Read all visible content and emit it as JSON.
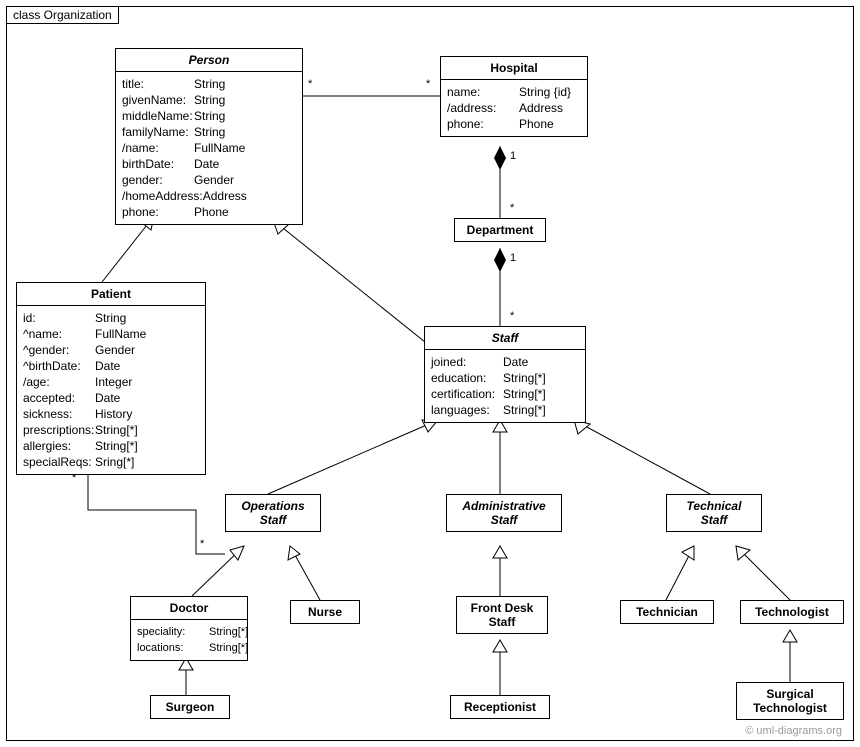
{
  "frame": {
    "label": "class Organization"
  },
  "classes": {
    "person": {
      "name": "Person",
      "abstract": true,
      "attrs": [
        {
          "name": "title:",
          "type": "String"
        },
        {
          "name": "givenName:",
          "type": "String"
        },
        {
          "name": "middleName:",
          "type": "String"
        },
        {
          "name": "familyName:",
          "type": "String"
        },
        {
          "name": "/name:",
          "type": "FullName"
        },
        {
          "name": "birthDate:",
          "type": "Date"
        },
        {
          "name": "gender:",
          "type": "Gender"
        },
        {
          "name": "/homeAddress:",
          "type": "Address"
        },
        {
          "name": "phone:",
          "type": "Phone"
        }
      ]
    },
    "hospital": {
      "name": "Hospital",
      "abstract": false,
      "attrs": [
        {
          "name": "name:",
          "type": "String {id}"
        },
        {
          "name": "/address:",
          "type": "Address"
        },
        {
          "name": "phone:",
          "type": "Phone"
        }
      ]
    },
    "department": {
      "name": "Department",
      "abstract": false,
      "attrs": []
    },
    "patient": {
      "name": "Patient",
      "abstract": false,
      "attrs": [
        {
          "name": "id:",
          "type": "String"
        },
        {
          "name": "^name:",
          "type": "FullName"
        },
        {
          "name": "^gender:",
          "type": "Gender"
        },
        {
          "name": "^birthDate:",
          "type": "Date"
        },
        {
          "name": "/age:",
          "type": "Integer"
        },
        {
          "name": "accepted:",
          "type": "Date"
        },
        {
          "name": "sickness:",
          "type": "History"
        },
        {
          "name": "prescriptions:",
          "type": "String[*]"
        },
        {
          "name": "allergies:",
          "type": "String[*]"
        },
        {
          "name": "specialReqs:",
          "type": "Sring[*]"
        }
      ]
    },
    "staff": {
      "name": "Staff",
      "abstract": true,
      "attrs": [
        {
          "name": "joined:",
          "type": "Date"
        },
        {
          "name": "education:",
          "type": "String[*]"
        },
        {
          "name": "certification:",
          "type": "String[*]"
        },
        {
          "name": "languages:",
          "type": "String[*]"
        }
      ]
    },
    "opsStaff": {
      "name": "Operations\nStaff",
      "abstract": true,
      "attrs": []
    },
    "adminStaff": {
      "name": "Administrative\nStaff",
      "abstract": true,
      "attrs": []
    },
    "techStaff": {
      "name": "Technical\nStaff",
      "abstract": true,
      "attrs": []
    },
    "doctor": {
      "name": "Doctor",
      "abstract": false,
      "attrs": [
        {
          "name": "speciality:",
          "type": "String[*]"
        },
        {
          "name": "locations:",
          "type": "String[*]"
        }
      ]
    },
    "nurse": {
      "name": "Nurse",
      "abstract": false,
      "attrs": []
    },
    "frontDesk": {
      "name": "Front Desk\nStaff",
      "abstract": false,
      "attrs": []
    },
    "technician": {
      "name": "Technician",
      "abstract": false,
      "attrs": []
    },
    "technologist": {
      "name": "Technologist",
      "abstract": false,
      "attrs": []
    },
    "surgeon": {
      "name": "Surgeon",
      "abstract": false,
      "attrs": []
    },
    "receptionist": {
      "name": "Receptionist",
      "abstract": false,
      "attrs": []
    },
    "surgTech": {
      "name": "Surgical\nTechnologist",
      "abstract": false,
      "attrs": []
    }
  },
  "multiplicities": {
    "person_hospital_p": "*",
    "person_hospital_h": "*",
    "hospital_dept_h": "1",
    "hospital_dept_d": "*",
    "dept_staff_d": "1",
    "dept_staff_s": "*",
    "patient_ops_p": "*",
    "patient_ops_o": "*"
  },
  "watermark": "© uml-diagrams.org"
}
